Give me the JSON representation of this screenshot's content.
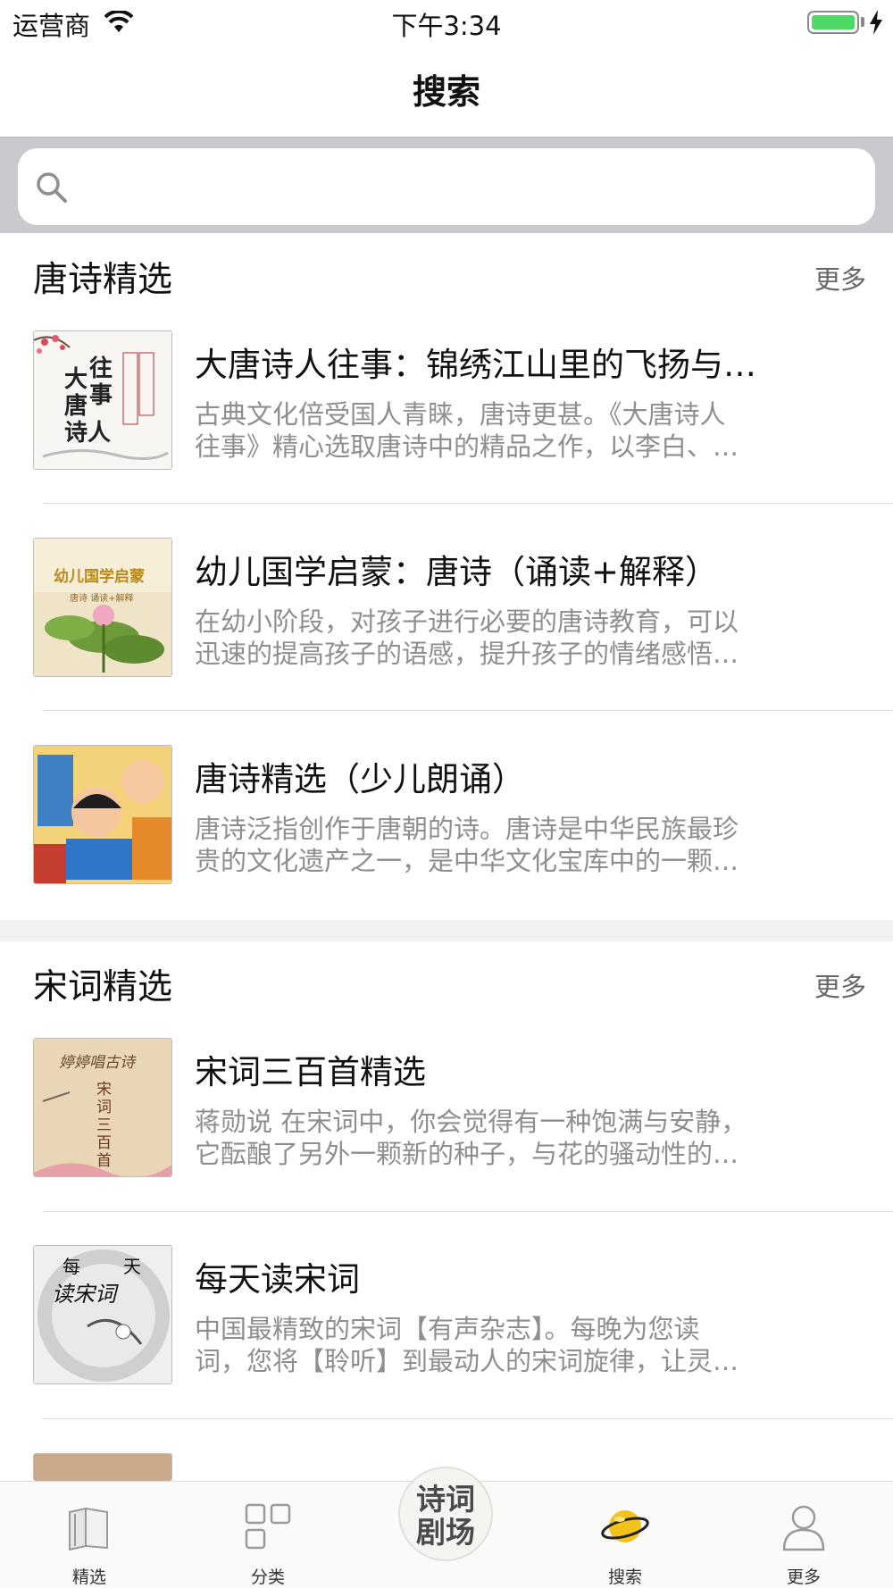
{
  "status_bar": {
    "carrier": "运营商",
    "time": "下午3:34"
  },
  "nav": {
    "title": "搜索"
  },
  "search": {
    "placeholder": ""
  },
  "sections": [
    {
      "title": "唐诗精选",
      "more": "更多",
      "items": [
        {
          "title": "大唐诗人往事：锦绣江山里的飞扬与…",
          "desc_line1": "古典文化倍受国人青睐，唐诗更甚。《大唐诗人",
          "desc_line2": "往事》精心选取唐诗中的精品之作，以李白、…",
          "cover": "大唐诗人往事"
        },
        {
          "title": "幼儿国学启蒙：唐诗（诵读+解释）",
          "desc_line1": "在幼小阶段，对孩子进行必要的唐诗教育，可以",
          "desc_line2": "迅速的提高孩子的语感，提升孩子的情绪感悟…",
          "cover": "幼儿国学启蒙"
        },
        {
          "title": "唐诗精选（少儿朗诵）",
          "desc_line1": "唐诗泛指创作于唐朝的诗。唐诗是中华民族最珍",
          "desc_line2": "贵的文化遗产之一，是中华文化宝库中的一颗…",
          "cover": ""
        }
      ]
    },
    {
      "title": "宋词精选",
      "more": "更多",
      "items": [
        {
          "title": "宋词三百首精选",
          "desc_line1": "蒋勋说 在宋词中，你会觉得有一种饱满与安静，",
          "desc_line2": "它酝酿了另外一颗新的种子，与花的骚动性的…",
          "cover": "宋词三百首"
        },
        {
          "title": "每天读宋词",
          "desc_line1": "中国最精致的宋词【有声杂志】。每晚为您读",
          "desc_line2": "词，您将【聆听】到最动人的宋词旋律，让灵…",
          "cover": "每天读宋词"
        }
      ]
    }
  ],
  "tabbar": {
    "tabs": [
      {
        "label": "精选",
        "icon": "book-icon"
      },
      {
        "label": "分类",
        "icon": "grid-icon"
      },
      {
        "label": "诗词剧场",
        "icon": "theater-icon"
      },
      {
        "label": "搜索",
        "icon": "planet-icon"
      },
      {
        "label": "更多",
        "icon": "person-icon"
      }
    ],
    "center_line1": "诗词",
    "center_line2": "剧场"
  },
  "colors": {
    "active_tab": "#f3c21b",
    "battery": "#4cd964",
    "muted_text": "#8e8e8e"
  }
}
